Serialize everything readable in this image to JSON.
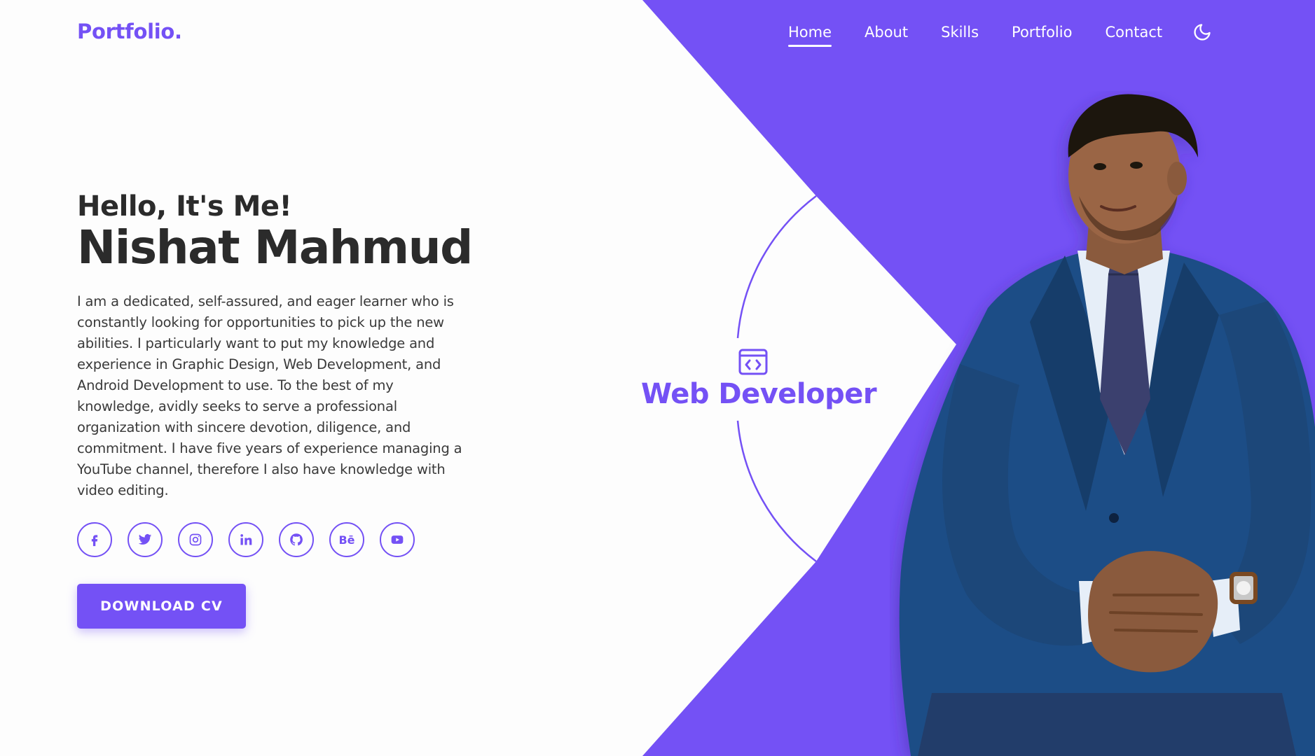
{
  "brand": {
    "logo": "Portfolio."
  },
  "nav": {
    "items": [
      {
        "label": "Home",
        "active": true
      },
      {
        "label": "About",
        "active": false
      },
      {
        "label": "Skills",
        "active": false
      },
      {
        "label": "Portfolio",
        "active": false
      },
      {
        "label": "Contact",
        "active": false
      }
    ],
    "theme_toggle_icon": "moon-icon"
  },
  "hero": {
    "greeting": "Hello, It's Me!",
    "name": "Nishat Mahmud",
    "bio": "I am a dedicated, self-assured, and eager learner who is constantly looking for opportunities to pick up the new abilities. I particularly want to put my knowledge and experience in Graphic Design, Web Development, and Android Development to use. To the best of my knowledge, avidly seeks to serve a professional organization with sincere devotion, diligence, and commitment. I have five years of experience managing a YouTube channel, therefore I also have knowledge with video editing.",
    "socials": [
      "facebook-icon",
      "twitter-icon",
      "instagram-icon",
      "linkedin-icon",
      "github-icon",
      "behance-icon",
      "youtube-icon"
    ],
    "behance_text": "Bē",
    "cta_label": "DOWNLOAD CV"
  },
  "role": {
    "icon": "code-window-icon",
    "title": "Web Developer"
  },
  "colors": {
    "accent": "#7451f5",
    "background": "#fdfdfd",
    "text": "#2b2b2b",
    "suit": "#1f4e86"
  }
}
